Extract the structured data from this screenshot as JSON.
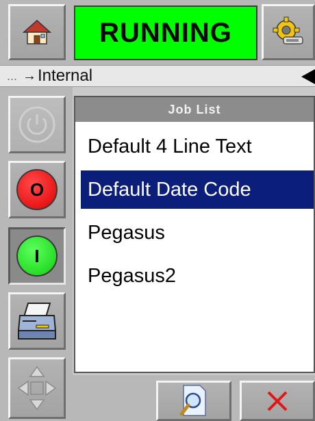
{
  "header": {
    "status": "RUNNING",
    "status_color": "#00ff00"
  },
  "breadcrumb": {
    "prefix": "...",
    "arrow": "→",
    "location": "Internal"
  },
  "sidebar": {
    "buttons": [
      {
        "name": "power",
        "icon": "power-icon"
      },
      {
        "name": "stop",
        "label": "O",
        "icon": "stop-icon"
      },
      {
        "name": "start",
        "label": "I",
        "icon": "start-icon"
      },
      {
        "name": "print",
        "icon": "printer-icon"
      },
      {
        "name": "navigate",
        "icon": "direction-pad-icon"
      }
    ]
  },
  "job_list": {
    "title": "Job List",
    "items": [
      {
        "label": "Default 4 Line Text",
        "selected": false
      },
      {
        "label": "Default Date Code",
        "selected": true
      },
      {
        "label": "Pegasus",
        "selected": false
      },
      {
        "label": "Pegasus2",
        "selected": false
      }
    ],
    "selected_color": "#0a1e7a"
  },
  "bottom": {
    "buttons": [
      {
        "name": "preview",
        "icon": "document-search-icon"
      },
      {
        "name": "cancel",
        "icon": "close-icon"
      }
    ]
  }
}
